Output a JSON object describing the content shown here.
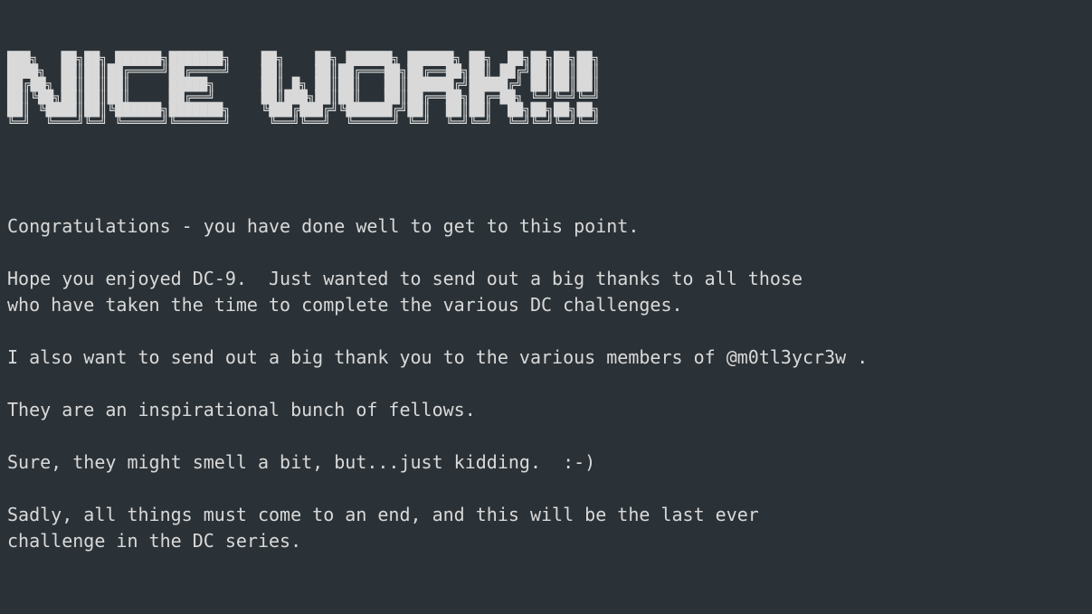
{
  "banner": {
    "text_plain": "NICE WORK!!!",
    "ascii_rows": [
      "███╗   ██╗██╗ ██████╗███████╗    ██╗    ██╗ ██████╗ ██████╗ ██╗  ██╗██╗██╗██╗",
      "████╗  ██║██║██╔════╝██╔════╝    ██║    ██║██╔═══██╗██╔══██╗██║ ██╔╝██║██║██║",
      "██╔██╗ ██║██║██║     █████╗      ██║ █╗ ██║██║   ██║██████╔╝█████╔╝ ██║██║██║",
      "██║╚██╗██║██║██║     ██╔══╝      ██║███╗██║██║   ██║██╔══██╗██╔═██╗ ╚═╝╚═╝╚═╝",
      "██║ ╚████║██║╚██████╗███████╗    ╚███╔███╔╝╚██████╔╝██║  ██║██║  ██╗██╗██╗██╗",
      "╚═╝  ╚═══╝╚═╝ ╚═════╝╚══════╝     ╚══╝╚══╝  ╚═════╝ ╚═╝  ╚═╝╚═╝  ╚═╝╚═╝╚═╝╚═╝"
    ]
  },
  "message": {
    "lines": [
      "",
      "Congratulations - you have done well to get to this point.",
      "",
      "Hope you enjoyed DC-9.  Just wanted to send out a big thanks to all those",
      "who have taken the time to complete the various DC challenges.",
      "",
      "I also want to send out a big thank you to the various members of @m0tl3ycr3w .",
      "",
      "They are an inspirational bunch of fellows.",
      "",
      "Sure, they might smell a bit, but...just kidding.  :-)",
      "",
      "Sadly, all things must come to an end, and this will be the last ever",
      "challenge in the DC series."
    ]
  },
  "colors": {
    "bg": "#2b3237",
    "fg": "#d9d9d9"
  }
}
